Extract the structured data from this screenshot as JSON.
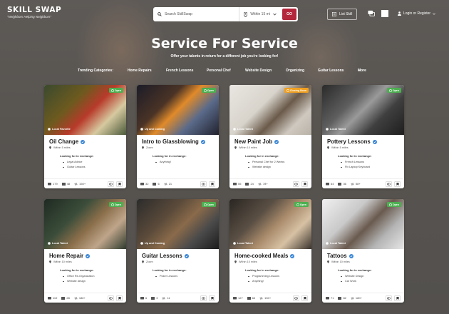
{
  "header": {
    "logo": "SKILL SWAP",
    "tagline": "\"Neighbors Helping Neighbors\"",
    "search_placeholder": "Search SkillSwap",
    "location_select": "Within 15 mi",
    "go_label": "GO",
    "list_skill_label": "List Skill",
    "login_label": "Login or Register"
  },
  "hero": {
    "title": "Service For Service",
    "subtitle": "Offer your talents in return for a different job you're looking for!"
  },
  "categories": {
    "heading": "Trending Categories:",
    "items": [
      "Home Repairs",
      "French Lessons",
      "Personal Chef",
      "Website Design",
      "Organizing",
      "Guitar Lessons"
    ],
    "more": "More"
  },
  "common": {
    "looking_label": "Looking for in exchange:"
  },
  "cards": [
    {
      "title": "Oil Change",
      "location": "Within 5 miles",
      "tag": "Local Favorite",
      "badge": "Open",
      "badge_color": "#4caf50",
      "exchange": [
        "Legal Advice",
        "Guitar Lessons"
      ],
      "stats": [
        "179",
        "48",
        "150+"
      ]
    },
    {
      "title": "Intro to Glassblowing",
      "location": "Zoom",
      "tag": "Up and Coming",
      "badge": "Open",
      "badge_color": "#4caf50",
      "exchange": [
        "Anything!"
      ],
      "stats": [
        "32",
        "6",
        "21"
      ]
    },
    {
      "title": "New Paint Job",
      "location": "Within 10 miles",
      "tag": "Local Talent",
      "badge": "Closing Soon",
      "badge_color": "#f0a020",
      "exchange": [
        "Personal Chef for 2 Weeks",
        "Website design"
      ],
      "stats": [
        "55",
        "24",
        "78+"
      ]
    },
    {
      "title": "Pottery Lessons",
      "location": "Within 5 miles",
      "tag": "Local Talent",
      "badge": "Open",
      "badge_color": "#4caf50",
      "exchange": [
        "French Lessons",
        "Fix Laptop Keyboard"
      ],
      "stats": [
        "64",
        "36",
        "58+"
      ]
    },
    {
      "title": "Home Repair",
      "location": "Within 10 miles",
      "tag": "Local Talent",
      "badge": "Open",
      "badge_color": "#4caf50",
      "exchange": [
        "Office Re-Organization",
        "Website design"
      ],
      "stats": [
        "119",
        "28",
        "180+"
      ]
    },
    {
      "title": "Guitar Lessons",
      "location": "Zoom",
      "tag": "Up and Coming",
      "badge": "Open",
      "badge_color": "#4caf50",
      "exchange": [
        "Poker Lessons"
      ],
      "stats": [
        "6",
        "3",
        "11"
      ]
    },
    {
      "title": "Home-cooked Meals",
      "location": "Within 10 miles",
      "tag": "Local Talent",
      "badge": "Open",
      "badge_color": "#4caf50",
      "exchange": [
        "Programming Lessons",
        "Anything!"
      ],
      "stats": [
        "127",
        "63",
        "150+"
      ]
    },
    {
      "title": "Tattoos",
      "location": "Within 10 miles",
      "tag": "Local Talent",
      "badge": "Open",
      "badge_color": "#4caf50",
      "exchange": [
        "Website Design",
        "Car Work"
      ],
      "stats": [
        "71",
        "82",
        "180+"
      ]
    }
  ]
}
